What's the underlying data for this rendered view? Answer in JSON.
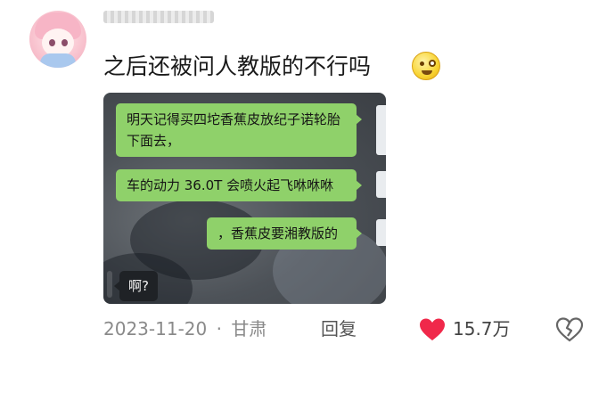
{
  "comment": {
    "text": "之后还被问人教版的不行吗",
    "emoji": "smirk-emoji"
  },
  "chat": {
    "messages": [
      {
        "side": "right",
        "text": "明天记得买四坨香蕉皮放纪子诺轮胎下面去，"
      },
      {
        "side": "right",
        "text": "车的动力 36.0T 会喷火起飞咻咻咻"
      },
      {
        "side": "right",
        "text": "，香蕉皮要湘教版的"
      },
      {
        "side": "left",
        "text": "啊?"
      }
    ]
  },
  "footer": {
    "date": "2023-11-20",
    "separator": "·",
    "location": "甘肃",
    "reply_label": "回复",
    "likes": "15.7万"
  },
  "colors": {
    "bubble_green": "#8fd16a",
    "like_red": "#f0284a"
  },
  "icons": [
    "avatar",
    "smirk-emoji",
    "heart-icon",
    "broken-heart-icon"
  ]
}
